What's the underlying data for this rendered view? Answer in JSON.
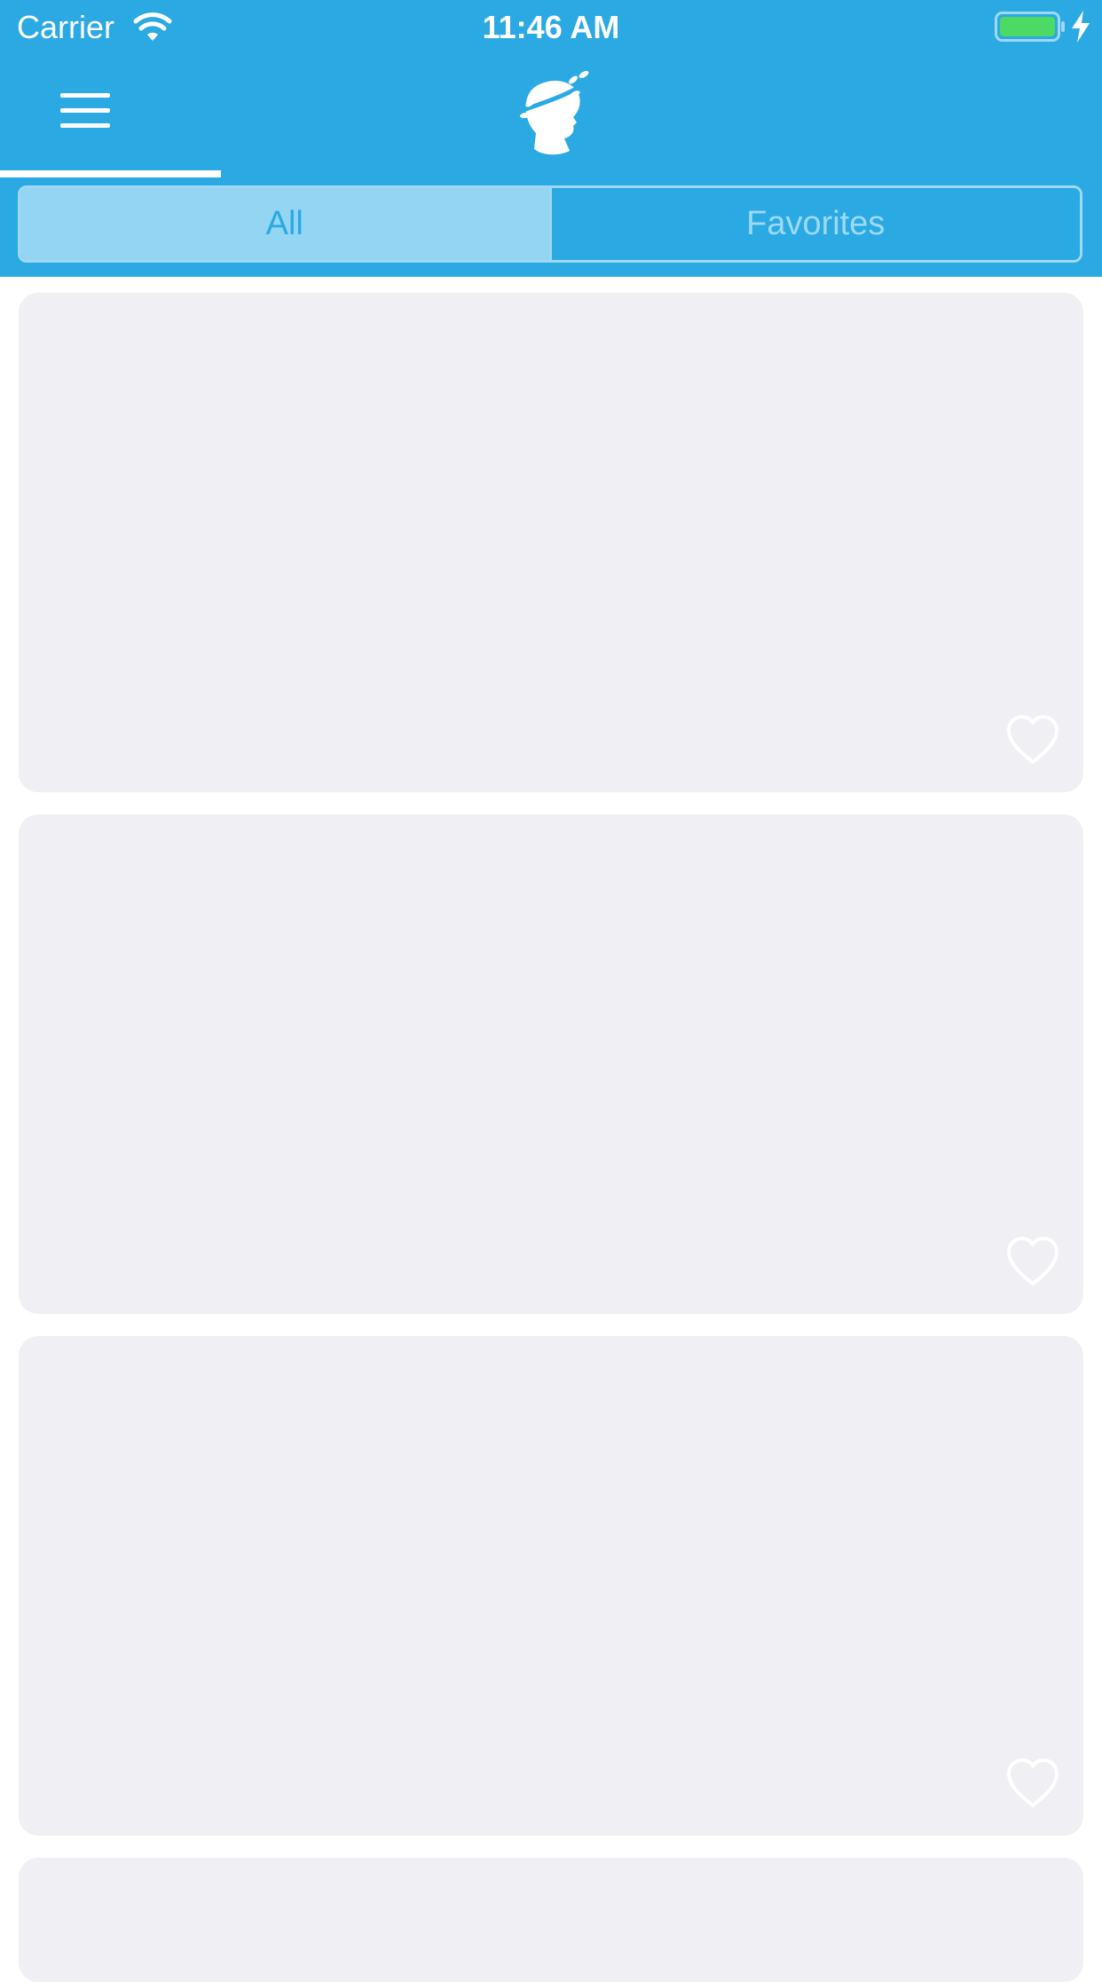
{
  "status_bar": {
    "carrier": "Carrier",
    "time": "11:46 AM",
    "icons": [
      "wifi-icon",
      "battery-icon",
      "charging-bolt-icon"
    ]
  },
  "nav": {
    "menu_icon": "hamburger-menu-icon",
    "logo_icon": "laurel-head-logo-icon"
  },
  "tabs": [
    {
      "label": "All",
      "selected": true
    },
    {
      "label": "Favorites",
      "selected": false
    }
  ],
  "cards": [
    {
      "icon": "heart-outline-icon",
      "favorited": false
    },
    {
      "icon": "heart-outline-icon",
      "favorited": false
    },
    {
      "icon": "heart-outline-icon",
      "favorited": false
    },
    {
      "icon": "",
      "favorited": false
    }
  ],
  "colors": {
    "header": "#2aa9e2",
    "segment_selected": "#93d5f2",
    "segment_border": "#9ed8f3",
    "card": "#efeff4",
    "battery": "#4cd964"
  }
}
